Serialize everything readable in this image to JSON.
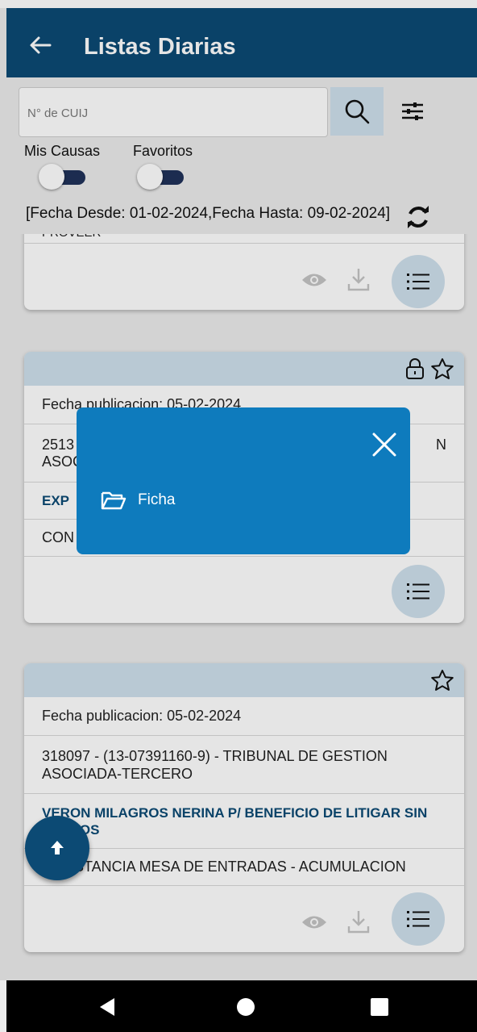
{
  "app_bar": {
    "title": "Listas Diarias",
    "back_icon": "arrow-left-icon"
  },
  "search": {
    "placeholder": "N° de CUIJ",
    "search_icon": "search-icon",
    "filter_icon": "sliders-icon"
  },
  "toggles": [
    {
      "label": "Mis Causas",
      "on": true
    },
    {
      "label": "Favoritos",
      "on": true
    }
  ],
  "date_range": {
    "text": "[Fecha Desde: 01-02-2024,Fecha Hasta: 09-02-2024]",
    "refresh_icon": "refresh-icon"
  },
  "cards": [
    {
      "top_text": "PROVEER"
    },
    {
      "fecha": "Fecha publicacion: 05-02-2024",
      "expediente": "2513",
      "expediente_tail": "N",
      "expediente_line2": "ASOC",
      "caratula": "EXP",
      "decreto": "CON"
    },
    {
      "fecha": "Fecha publicacion: 05-02-2024",
      "expediente": "318097 - (13-07391160-9)  - TRIBUNAL DE GESTION ASOCIADA-TERCERO",
      "caratula": "VERON MILAGROS NERINA  P/ BENEFICIO DE LITIGAR SIN GASTOS",
      "decreto": "CONSTANCIA MESA DE ENTRADAS - ACUMULACION"
    }
  ],
  "popup": {
    "item_label": "Ficha",
    "item_icon": "folder-open-icon",
    "close_icon": "close-icon"
  },
  "colors": {
    "primary": "#0c4a74",
    "popup": "#0e7bbd",
    "accent_light": "#cfe0ec"
  }
}
